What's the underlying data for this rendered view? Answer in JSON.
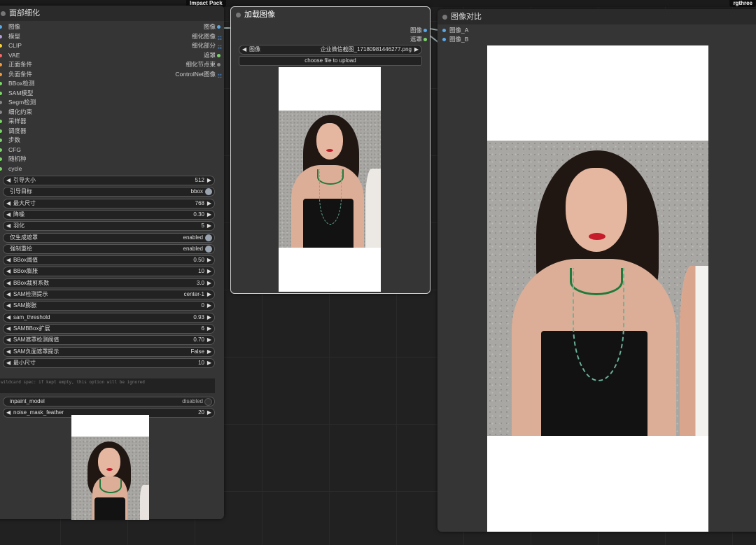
{
  "canvas": {
    "top_tags": {
      "impact": "Impact Pack",
      "rgthree": "rgthree"
    }
  },
  "facedetailer": {
    "title": "面部细化",
    "inputs": [
      {
        "label": "图像",
        "color": "#5aa7e6"
      },
      {
        "label": "模型",
        "color": "#b39ddb"
      },
      {
        "label": "CLIP",
        "color": "#f5d142"
      },
      {
        "label": "VAE",
        "color": "#ef6a6a"
      },
      {
        "label": "正面条件",
        "color": "#f29a3a"
      },
      {
        "label": "负面条件",
        "color": "#f29a3a"
      },
      {
        "label": "BBox检测",
        "color": "#7cd36a"
      },
      {
        "label": "SAM模型",
        "color": "#7cd36a"
      },
      {
        "label": "Segm检测",
        "color": "#888888"
      },
      {
        "label": "细化约束",
        "color": "#888888"
      },
      {
        "label": "采样器",
        "color": "#7cd36a"
      },
      {
        "label": "调度器",
        "color": "#7cd36a"
      },
      {
        "label": "步数",
        "color": "#7cd36a"
      },
      {
        "label": "CFG",
        "color": "#7cd36a"
      },
      {
        "label": "随机种",
        "color": "#7cd36a"
      },
      {
        "label": "cycle",
        "color": "#7cd36a"
      }
    ],
    "outputs": [
      {
        "label": "图像",
        "color": "#5aa7e6",
        "icon": "dot"
      },
      {
        "label": "细化图像",
        "color": "#5aa7e6",
        "icon": "grid"
      },
      {
        "label": "细化部分",
        "color": "#5aa7e6",
        "icon": "grid"
      },
      {
        "label": "遮罩",
        "color": "#7cd36a",
        "icon": "dot"
      },
      {
        "label": "细化节点束",
        "color": "#888888",
        "icon": "dot"
      },
      {
        "label": "ControlNet图像",
        "color": "#5aa7e6",
        "icon": "grid"
      }
    ],
    "widgets": [
      {
        "label": "引导大小",
        "value": "512",
        "kind": "number"
      },
      {
        "label": "引导目标",
        "value": "bbox",
        "kind": "toggle"
      },
      {
        "label": "最大尺寸",
        "value": "768",
        "kind": "number"
      },
      {
        "label": "降噪",
        "value": "0.30",
        "kind": "number"
      },
      {
        "label": "羽化",
        "value": "5",
        "kind": "number"
      },
      {
        "label": "仅生成遮罩",
        "value": "enabled",
        "kind": "toggle"
      },
      {
        "label": "强制重绘",
        "value": "enabled",
        "kind": "toggle"
      },
      {
        "label": "BBox阈值",
        "value": "0.50",
        "kind": "number"
      },
      {
        "label": "BBox膨胀",
        "value": "10",
        "kind": "number"
      },
      {
        "label": "BBox裁剪系数",
        "value": "3.0",
        "kind": "number"
      },
      {
        "label": "SAM检测提示",
        "value": "center-1",
        "kind": "number"
      },
      {
        "label": "SAM膨胀",
        "value": "0",
        "kind": "number"
      },
      {
        "label": "sam_threshold",
        "value": "0.93",
        "kind": "number"
      },
      {
        "label": "SAMBBox扩展",
        "value": "6",
        "kind": "number"
      },
      {
        "label": "SAM遮罩检测阈值",
        "value": "0.70",
        "kind": "number"
      },
      {
        "label": "SAM负面遮罩提示",
        "value": "False",
        "kind": "number"
      },
      {
        "label": "最小尺寸",
        "value": "10",
        "kind": "number"
      }
    ],
    "wildcard_placeholder": "wildcard spec: if kept empty, this option will be ignored",
    "inpaint": {
      "label": "inpaint_model",
      "value": "disabled"
    },
    "noise": {
      "label": "noise_mask_feather",
      "value": "20"
    }
  },
  "loadimage": {
    "title": "加载图像",
    "outputs": [
      {
        "label": "图像",
        "color": "#5aa7e6"
      },
      {
        "label": "遮罩",
        "color": "#7cd36a"
      }
    ],
    "image_widget": {
      "label": "图像",
      "value": "企业微信截图_17180981446277.png"
    },
    "upload_label": "choose file to upload"
  },
  "compare": {
    "title": "图像对比",
    "inputs": [
      {
        "label": "图像_A",
        "color": "#5aa7e6"
      },
      {
        "label": "图像_B",
        "color": "#5aa7e6"
      }
    ]
  }
}
